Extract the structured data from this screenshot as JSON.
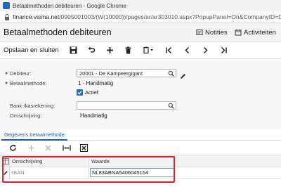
{
  "browser": {
    "window_title": "Betaalmethoden debiteuren - Google Chrome",
    "url_host": "finance.visma.net",
    "url_path": "/0905001003/(W(10000))/pages/ar/ar303010.aspx?PopupPanel=On&CompanyID=De+Cam"
  },
  "header": {
    "title": "Betaalmethoden debiteuren",
    "notes_label": "Notities",
    "activities_label": "Activiteiten"
  },
  "toolbar": {
    "save_close_label": "Opslaan en sluiten"
  },
  "form": {
    "customer_label": "Debiteur:",
    "customer_value": "20001 - De Kampeergigant",
    "payment_method_label": "Betaalmethode:",
    "payment_method_value": "1 - Handmatig",
    "active_label": "Actief",
    "bank_label": "Bank-/kasrekening:",
    "bank_value": "",
    "description_label": "Omschrijving:",
    "description_value": "Handmatig"
  },
  "tabs": {
    "details_label": "Gegevens betaalmethode"
  },
  "grid": {
    "columns": [
      "Omschrijving",
      "Waarde"
    ],
    "rows": [
      {
        "description": "IBAN",
        "value": "NL83ABNA5406045164"
      }
    ]
  },
  "colors": {
    "accent": "#1b6fc2",
    "highlight": "#e0202a"
  }
}
